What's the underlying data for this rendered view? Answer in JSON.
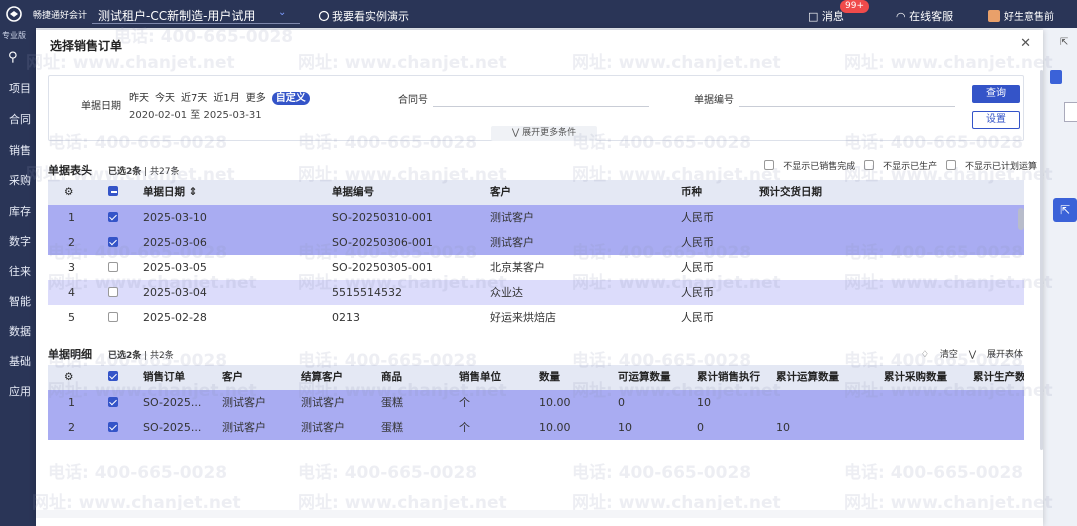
{
  "topbar": {
    "brand": "畅捷通好会计",
    "tenant": "测试租户-CC新制造-用户试用",
    "demo_link": "我要看实例演示",
    "messages_label": "消息",
    "messages_badge": "99+",
    "service_label": "在线客服",
    "user_label": "好生意售前"
  },
  "sidebar": {
    "top_label": "专业版",
    "items": [
      "项目",
      "合同",
      "销售",
      "采购",
      "库存",
      "数字",
      "往来",
      "智能",
      "数据",
      "基础",
      "应用"
    ]
  },
  "modal": {
    "title": "选择销售订单",
    "filters": {
      "date_label": "单据日期",
      "quick_dates": [
        "昨天",
        "今天",
        "近7天",
        "近1月",
        "更多",
        "自定义"
      ],
      "date_range": "2020-02-01 至 2025-03-31",
      "contract_label": "合同号",
      "doc_no_label": "单据编号",
      "query_button": "查询",
      "settings_button": "设置",
      "expand_more": "展开更多条件"
    },
    "header_section": {
      "title": "单据表头",
      "selected": "已选2条",
      "total": "| 共27条",
      "options": [
        "不显示已销售完成",
        "不显示已生产",
        "不显示已计划运算"
      ],
      "columns": [
        "单据日期",
        "单据编号",
        "客户",
        "币种",
        "预计交货日期"
      ],
      "rows": [
        {
          "no": "1",
          "date": "2025-03-10",
          "code": "SO-20250310-001",
          "customer": "测试客户",
          "currency": "人民币",
          "delivery": ""
        },
        {
          "no": "2",
          "date": "2025-03-06",
          "code": "SO-20250306-001",
          "customer": "测试客户",
          "currency": "人民币",
          "delivery": ""
        },
        {
          "no": "3",
          "date": "2025-03-05",
          "code": "SO-20250305-001",
          "customer": "北京某客户",
          "currency": "人民币",
          "delivery": ""
        },
        {
          "no": "4",
          "date": "2025-03-04",
          "code": "5515514532",
          "customer": "众业达",
          "currency": "人民币",
          "delivery": ""
        },
        {
          "no": "5",
          "date": "2025-02-28",
          "code": "0213",
          "customer": "好运来烘焙店",
          "currency": "人民币",
          "delivery": ""
        }
      ]
    },
    "detail_section": {
      "title": "单据明细",
      "selected": "已选2条",
      "total": "| 共2条",
      "clear_label": "清空",
      "expand_label": "展开表体",
      "columns": [
        "销售订单",
        "客户",
        "结算客户",
        "商品",
        "销售单位",
        "数量",
        "可运算数量",
        "累计销售执行",
        "累计运算数量",
        "累计采购数量",
        "累计生产数"
      ],
      "rows": [
        {
          "no": "1",
          "order": "SO-2025...",
          "customer": "测试客户",
          "settle": "测试客户",
          "product": "蛋糕",
          "unit": "个",
          "qty": "10.00",
          "calc_qty": "0",
          "sales_exec": "10",
          "calc_total": "",
          "purchase": "",
          "production": ""
        },
        {
          "no": "2",
          "order": "SO-2025...",
          "customer": "测试客户",
          "settle": "测试客户",
          "product": "蛋糕",
          "unit": "个",
          "qty": "10.00",
          "calc_qty": "10",
          "sales_exec": "0",
          "calc_total": "10",
          "purchase": "",
          "production": ""
        }
      ]
    }
  },
  "watermark": {
    "phone": "电话: 400-665-0028",
    "site": "网址: www.chanjet.net"
  }
}
